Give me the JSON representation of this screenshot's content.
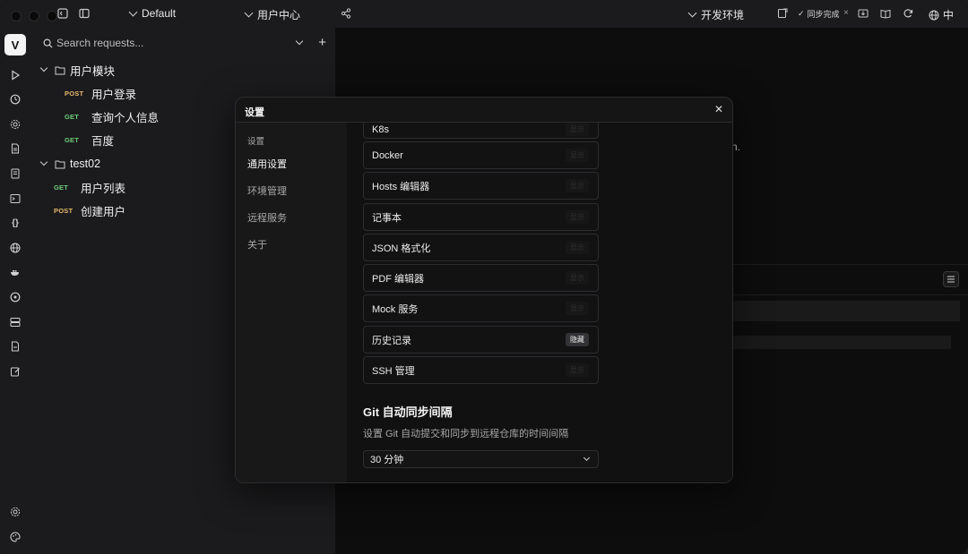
{
  "titlebar": {
    "workspace": "Default",
    "project": "用户中心",
    "environment": "开发环境",
    "sync_status": "同步完成",
    "language": "中"
  },
  "sidebar": {
    "search_placeholder": "Search requests...",
    "tree": [
      {
        "type": "folder",
        "label": "用户模块"
      },
      {
        "type": "request",
        "method": "POST",
        "label": "用户登录"
      },
      {
        "type": "request",
        "method": "GET",
        "label": "查询个人信息"
      },
      {
        "type": "request",
        "method": "GET",
        "label": "百度"
      },
      {
        "type": "folder",
        "label": "test02"
      },
      {
        "type": "request",
        "method": "GET",
        "label": "用户列表"
      },
      {
        "type": "request",
        "method": "POST",
        "label": "创建用户"
      }
    ]
  },
  "rail": {
    "logo": "V",
    "icons": [
      "play-icon",
      "history-icon",
      "settings-cog-icon",
      "document-icon",
      "notebook-icon",
      "terminal-icon",
      "json-icon",
      "globe-icon",
      "docker-icon",
      "kubernetes-icon",
      "server-icon",
      "file-icon",
      "edit-icon"
    ],
    "bottom_icons": [
      "gear-icon",
      "palette-icon"
    ]
  },
  "main": {
    "partial_text": "n."
  },
  "settings_modal": {
    "title": "设置",
    "nav_heading": "设置",
    "nav_items": [
      "通用设置",
      "环境管理",
      "远程服务",
      "关于"
    ],
    "active_nav": "通用设置",
    "tools": [
      {
        "name": "K8s",
        "badge": "显示"
      },
      {
        "name": "Docker",
        "badge": "显示"
      },
      {
        "name": "Hosts 编辑器",
        "badge": "显示"
      },
      {
        "name": "记事本",
        "badge": "显示"
      },
      {
        "name": "JSON 格式化",
        "badge": "显示"
      },
      {
        "name": "PDF 编辑器",
        "badge": "显示"
      },
      {
        "name": "Mock 服务",
        "badge": "显示"
      },
      {
        "name": "历史记录",
        "badge": "隐藏"
      },
      {
        "name": "SSH 管理",
        "badge": "显示"
      }
    ],
    "git_section_title": "Git 自动同步间隔",
    "git_section_desc": "设置 Git 自动提交和同步到远程仓库的时间间隔",
    "git_interval_value": "30 分钟"
  }
}
